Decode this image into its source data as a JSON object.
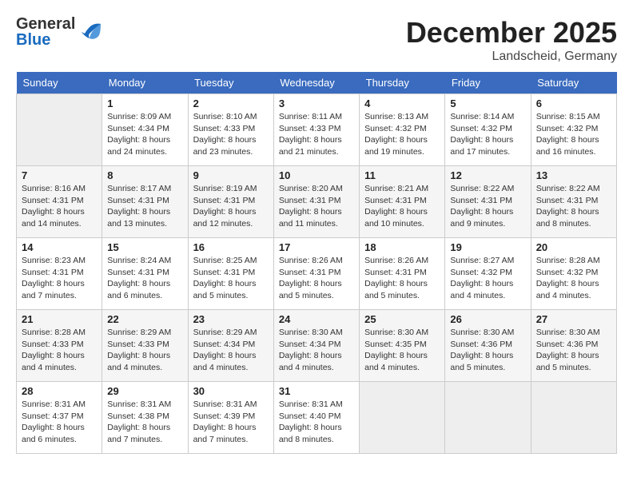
{
  "header": {
    "logo_general": "General",
    "logo_blue": "Blue",
    "month": "December 2025",
    "location": "Landscheid, Germany"
  },
  "days_of_week": [
    "Sunday",
    "Monday",
    "Tuesday",
    "Wednesday",
    "Thursday",
    "Friday",
    "Saturday"
  ],
  "weeks": [
    [
      {
        "day": "",
        "info": ""
      },
      {
        "day": "1",
        "info": "Sunrise: 8:09 AM\nSunset: 4:34 PM\nDaylight: 8 hours\nand 24 minutes."
      },
      {
        "day": "2",
        "info": "Sunrise: 8:10 AM\nSunset: 4:33 PM\nDaylight: 8 hours\nand 23 minutes."
      },
      {
        "day": "3",
        "info": "Sunrise: 8:11 AM\nSunset: 4:33 PM\nDaylight: 8 hours\nand 21 minutes."
      },
      {
        "day": "4",
        "info": "Sunrise: 8:13 AM\nSunset: 4:32 PM\nDaylight: 8 hours\nand 19 minutes."
      },
      {
        "day": "5",
        "info": "Sunrise: 8:14 AM\nSunset: 4:32 PM\nDaylight: 8 hours\nand 17 minutes."
      },
      {
        "day": "6",
        "info": "Sunrise: 8:15 AM\nSunset: 4:32 PM\nDaylight: 8 hours\nand 16 minutes."
      }
    ],
    [
      {
        "day": "7",
        "info": "Sunrise: 8:16 AM\nSunset: 4:31 PM\nDaylight: 8 hours\nand 14 minutes."
      },
      {
        "day": "8",
        "info": "Sunrise: 8:17 AM\nSunset: 4:31 PM\nDaylight: 8 hours\nand 13 minutes."
      },
      {
        "day": "9",
        "info": "Sunrise: 8:19 AM\nSunset: 4:31 PM\nDaylight: 8 hours\nand 12 minutes."
      },
      {
        "day": "10",
        "info": "Sunrise: 8:20 AM\nSunset: 4:31 PM\nDaylight: 8 hours\nand 11 minutes."
      },
      {
        "day": "11",
        "info": "Sunrise: 8:21 AM\nSunset: 4:31 PM\nDaylight: 8 hours\nand 10 minutes."
      },
      {
        "day": "12",
        "info": "Sunrise: 8:22 AM\nSunset: 4:31 PM\nDaylight: 8 hours\nand 9 minutes."
      },
      {
        "day": "13",
        "info": "Sunrise: 8:22 AM\nSunset: 4:31 PM\nDaylight: 8 hours\nand 8 minutes."
      }
    ],
    [
      {
        "day": "14",
        "info": "Sunrise: 8:23 AM\nSunset: 4:31 PM\nDaylight: 8 hours\nand 7 minutes."
      },
      {
        "day": "15",
        "info": "Sunrise: 8:24 AM\nSunset: 4:31 PM\nDaylight: 8 hours\nand 6 minutes."
      },
      {
        "day": "16",
        "info": "Sunrise: 8:25 AM\nSunset: 4:31 PM\nDaylight: 8 hours\nand 5 minutes."
      },
      {
        "day": "17",
        "info": "Sunrise: 8:26 AM\nSunset: 4:31 PM\nDaylight: 8 hours\nand 5 minutes."
      },
      {
        "day": "18",
        "info": "Sunrise: 8:26 AM\nSunset: 4:31 PM\nDaylight: 8 hours\nand 5 minutes."
      },
      {
        "day": "19",
        "info": "Sunrise: 8:27 AM\nSunset: 4:32 PM\nDaylight: 8 hours\nand 4 minutes."
      },
      {
        "day": "20",
        "info": "Sunrise: 8:28 AM\nSunset: 4:32 PM\nDaylight: 8 hours\nand 4 minutes."
      }
    ],
    [
      {
        "day": "21",
        "info": "Sunrise: 8:28 AM\nSunset: 4:33 PM\nDaylight: 8 hours\nand 4 minutes."
      },
      {
        "day": "22",
        "info": "Sunrise: 8:29 AM\nSunset: 4:33 PM\nDaylight: 8 hours\nand 4 minutes."
      },
      {
        "day": "23",
        "info": "Sunrise: 8:29 AM\nSunset: 4:34 PM\nDaylight: 8 hours\nand 4 minutes."
      },
      {
        "day": "24",
        "info": "Sunrise: 8:30 AM\nSunset: 4:34 PM\nDaylight: 8 hours\nand 4 minutes."
      },
      {
        "day": "25",
        "info": "Sunrise: 8:30 AM\nSunset: 4:35 PM\nDaylight: 8 hours\nand 4 minutes."
      },
      {
        "day": "26",
        "info": "Sunrise: 8:30 AM\nSunset: 4:36 PM\nDaylight: 8 hours\nand 5 minutes."
      },
      {
        "day": "27",
        "info": "Sunrise: 8:30 AM\nSunset: 4:36 PM\nDaylight: 8 hours\nand 5 minutes."
      }
    ],
    [
      {
        "day": "28",
        "info": "Sunrise: 8:31 AM\nSunset: 4:37 PM\nDaylight: 8 hours\nand 6 minutes."
      },
      {
        "day": "29",
        "info": "Sunrise: 8:31 AM\nSunset: 4:38 PM\nDaylight: 8 hours\nand 7 minutes."
      },
      {
        "day": "30",
        "info": "Sunrise: 8:31 AM\nSunset: 4:39 PM\nDaylight: 8 hours\nand 7 minutes."
      },
      {
        "day": "31",
        "info": "Sunrise: 8:31 AM\nSunset: 4:40 PM\nDaylight: 8 hours\nand 8 minutes."
      },
      {
        "day": "",
        "info": ""
      },
      {
        "day": "",
        "info": ""
      },
      {
        "day": "",
        "info": ""
      }
    ]
  ]
}
